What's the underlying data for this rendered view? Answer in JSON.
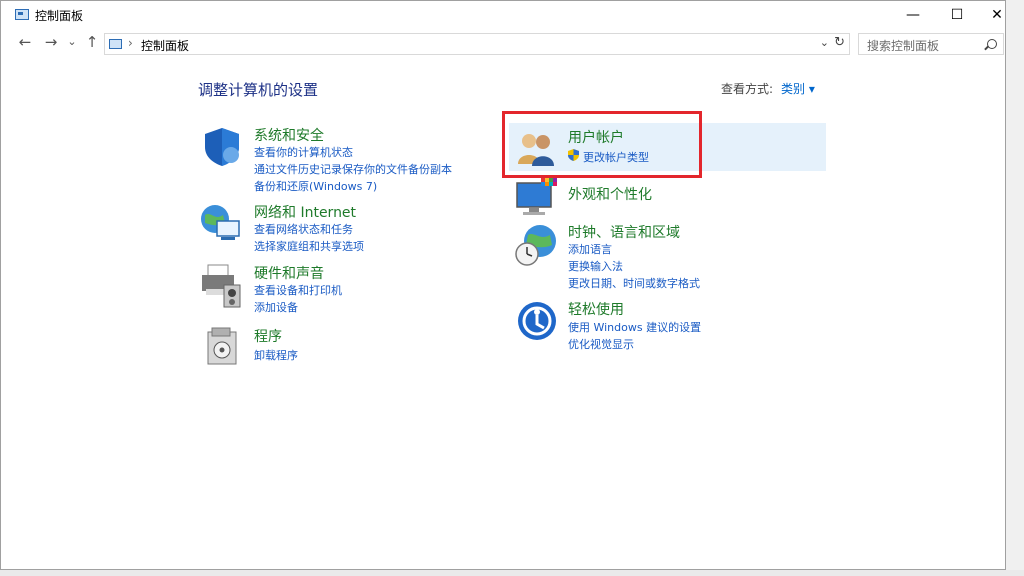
{
  "window": {
    "title": "控制面板",
    "buttons": {
      "minimize": "—",
      "maximize": "☐",
      "close": "✕"
    }
  },
  "nav": {
    "back": "←",
    "forward": "→",
    "recent": "⌄",
    "up": "↑"
  },
  "address": {
    "chevron": "›",
    "path": "控制面板",
    "dropdown": "⌄",
    "refresh": "↻"
  },
  "search": {
    "placeholder": "搜索控制面板"
  },
  "main": {
    "title": "调整计算机的设置",
    "view_by_label": "查看方式:",
    "view_by_value": "类别 ▾"
  },
  "categories_left": [
    {
      "name": "系统和安全",
      "icon": "shield-icon",
      "links": [
        "查看你的计算机状态",
        "通过文件历史记录保存你的文件备份副本",
        "备份和还原(Windows 7)"
      ]
    },
    {
      "name": "网络和 Internet",
      "icon": "network-globe-icon",
      "links": [
        "查看网络状态和任务",
        "选择家庭组和共享选项"
      ]
    },
    {
      "name": "硬件和声音",
      "icon": "printer-speaker-icon",
      "links": [
        "查看设备和打印机",
        "添加设备"
      ]
    },
    {
      "name": "程序",
      "icon": "programs-icon",
      "links": [
        "卸载程序"
      ]
    }
  ],
  "categories_right": [
    {
      "name": "用户帐户",
      "icon": "users-icon",
      "links": [
        "更改帐户类型"
      ]
    },
    {
      "name": "外观和个性化",
      "icon": "monitor-palette-icon",
      "links": []
    },
    {
      "name": "时钟、语言和区域",
      "icon": "clock-globe-icon",
      "links": [
        "添加语言",
        "更换输入法",
        "更改日期、时间或数字格式"
      ]
    },
    {
      "name": "轻松使用",
      "icon": "ease-of-access-icon",
      "links": [
        "使用 Windows 建议的设置",
        "优化视觉显示"
      ]
    }
  ],
  "colors": {
    "category_heading": "#1e7a2a",
    "link": "#1a5bc4",
    "title": "#1e3287",
    "highlight": "#e5f1fb",
    "annotation_box": "#e3262c"
  }
}
